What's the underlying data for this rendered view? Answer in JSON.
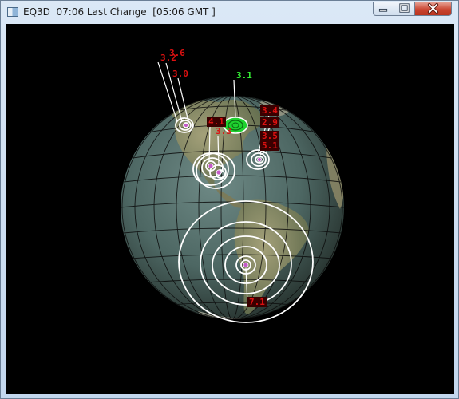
{
  "window": {
    "title": "EQ3D  07:06 Last Change  [05:06 GMT ]",
    "controls": {
      "minimize": "minimize",
      "maximize": "maximize",
      "close": "close"
    }
  },
  "colors": {
    "background": "#000000",
    "ocean": "#46605c",
    "grid": "#000000",
    "quake_ring": "#ffffff",
    "quake_dot": "#c45ac8",
    "recent_quake": "#22dd33",
    "label_red": "#dd1111",
    "label_green": "#33ee33",
    "label_box": "#3a0000"
  },
  "labels": {
    "m36": "3.6",
    "m32": "3.2",
    "m30": "3.0",
    "m31": "3.1",
    "m34": "3.4",
    "m29": "2.9",
    "m35": "3.5",
    "m51": "5.1",
    "m41": "4.1",
    "m33": "3.3",
    "m71": "7.1"
  }
}
